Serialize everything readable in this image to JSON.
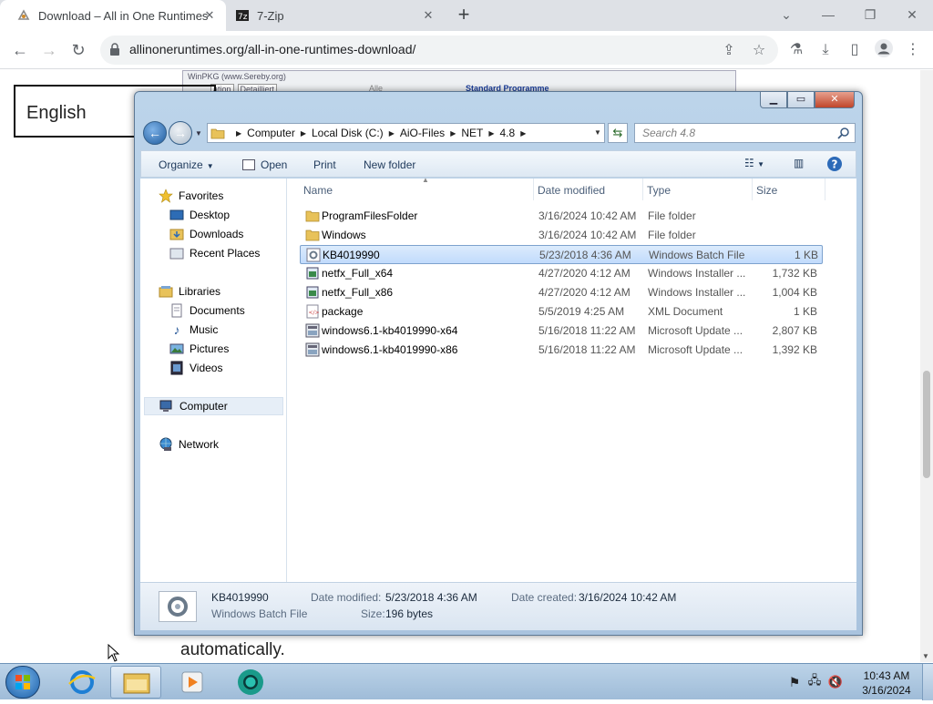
{
  "browser": {
    "tabs": [
      {
        "title": "Download – All in One Runtimes",
        "active": true
      },
      {
        "title": "7-Zip",
        "active": false
      }
    ],
    "url": "allinoneruntimes.org/all-in-one-runtimes-download/"
  },
  "webpage": {
    "language_box": "English",
    "bottom_text": "automatically.",
    "bg_screenshot": {
      "title": "WinPKG (www.Sereby.org)",
      "tab1": "ation",
      "tab2": "Detailliert",
      "check": "Alle",
      "section": "Standard Programme"
    }
  },
  "explorer": {
    "breadcrumb": [
      "Computer",
      "Local Disk (C:)",
      "AiO-Files",
      "NET",
      "4.8"
    ],
    "search_placeholder": "Search 4.8",
    "commands": {
      "organize": "Organize",
      "open": "Open",
      "print": "Print",
      "new_folder": "New folder"
    },
    "nav": {
      "favorites": "Favorites",
      "desktop": "Desktop",
      "downloads": "Downloads",
      "recent": "Recent Places",
      "libraries": "Libraries",
      "documents": "Documents",
      "music": "Music",
      "pictures": "Pictures",
      "videos": "Videos",
      "computer": "Computer",
      "network": "Network"
    },
    "columns": {
      "name": "Name",
      "date": "Date modified",
      "type": "Type",
      "size": "Size"
    },
    "files": [
      {
        "name": "ProgramFilesFolder",
        "date": "3/16/2024 10:42 AM",
        "type": "File folder",
        "size": "",
        "icon": "folder-icon"
      },
      {
        "name": "Windows",
        "date": "3/16/2024 10:42 AM",
        "type": "File folder",
        "size": "",
        "icon": "folder-icon"
      },
      {
        "name": "KB4019990",
        "date": "5/23/2018 4:36 AM",
        "type": "Windows Batch File",
        "size": "1 KB",
        "icon": "batch-file-icon",
        "selected": true
      },
      {
        "name": "netfx_Full_x64",
        "date": "4/27/2020 4:12 AM",
        "type": "Windows Installer ...",
        "size": "1,732 KB",
        "icon": "installer-icon"
      },
      {
        "name": "netfx_Full_x86",
        "date": "4/27/2020 4:12 AM",
        "type": "Windows Installer ...",
        "size": "1,004 KB",
        "icon": "installer-icon"
      },
      {
        "name": "package",
        "date": "5/5/2019 4:25 AM",
        "type": "XML Document",
        "size": "1 KB",
        "icon": "xml-icon"
      },
      {
        "name": "windows6.1-kb4019990-x64",
        "date": "5/16/2018 11:22 AM",
        "type": "Microsoft Update ...",
        "size": "2,807 KB",
        "icon": "update-package-icon"
      },
      {
        "name": "windows6.1-kb4019990-x86",
        "date": "5/16/2018 11:22 AM",
        "type": "Microsoft Update ...",
        "size": "1,392 KB",
        "icon": "update-package-icon"
      }
    ],
    "details": {
      "name": "KB4019990",
      "type": "Windows Batch File",
      "date_modified_label": "Date modified:",
      "date_modified": "5/23/2018 4:36 AM",
      "date_created_label": "Date created:",
      "date_created": "3/16/2024 10:42 AM",
      "size_label": "Size:",
      "size": "196 bytes"
    }
  },
  "taskbar": {
    "time": "10:43 AM",
    "date": "3/16/2024"
  },
  "colors": {
    "selection": "#c1dbfc",
    "taskbar": "#9fbcd8",
    "chrome_tabstrip": "#dee1e6"
  }
}
